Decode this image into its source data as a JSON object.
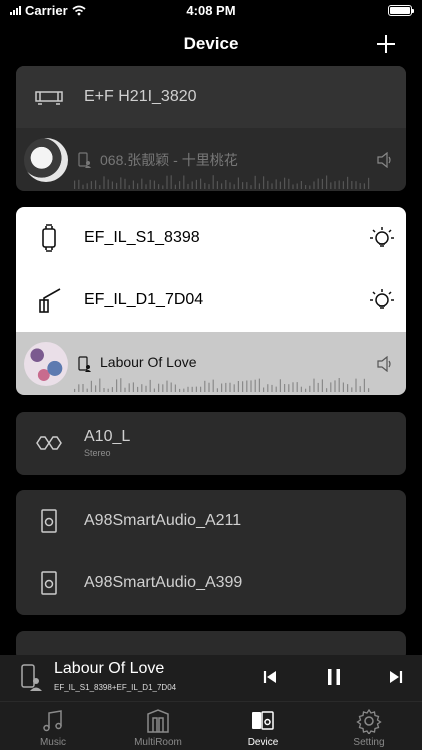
{
  "status": {
    "carrier": "Carrier",
    "time": "4:08 PM",
    "battery_level": 1.0
  },
  "nav": {
    "title": "Device",
    "add_icon": "plus-icon"
  },
  "groups": [
    {
      "devices": [
        {
          "name": "E+F H21I_3820",
          "icon": "soundbar-icon"
        }
      ],
      "now_playing": {
        "title": "068.张靓颖 - 十里桃花",
        "source_icon": "phone-icon",
        "volume_icon": "speaker-icon"
      }
    },
    {
      "devices": [
        {
          "name": "EF_IL_S1_8398",
          "icon": "table-lamp-icon",
          "light_icon": "light-bulb-icon"
        },
        {
          "name": "EF_IL_D1_7D04",
          "icon": "desk-lamp-icon",
          "light_icon": "light-bulb-icon"
        }
      ],
      "now_playing": {
        "title": "Labour Of Love",
        "source_icon": "phone-icon",
        "volume_icon": "speaker-icon"
      }
    },
    {
      "devices": [
        {
          "name": "A10_L",
          "subtitle": "Stereo",
          "icon": "stereo-pair-icon"
        }
      ]
    },
    {
      "devices": [
        {
          "name": "A98SmartAudio_A211",
          "icon": "speaker-box-icon"
        },
        {
          "name": "A98SmartAudio_A399",
          "icon": "speaker-box-icon"
        }
      ]
    }
  ],
  "mini_player": {
    "title": "Labour Of Love",
    "subtitle": "EF_IL_S1_8398+EF_IL_D1_7D04",
    "device_icon": "phone-icon",
    "controls": [
      "previous-icon",
      "pause-icon",
      "next-icon"
    ]
  },
  "tabs": [
    {
      "label": "Music",
      "icon": "music-note-icon",
      "active": false
    },
    {
      "label": "MultiRoom",
      "icon": "multiroom-icon",
      "active": false
    },
    {
      "label": "Device",
      "icon": "device-speaker-icon",
      "active": true
    },
    {
      "label": "Setting",
      "icon": "gear-icon",
      "active": false
    }
  ]
}
